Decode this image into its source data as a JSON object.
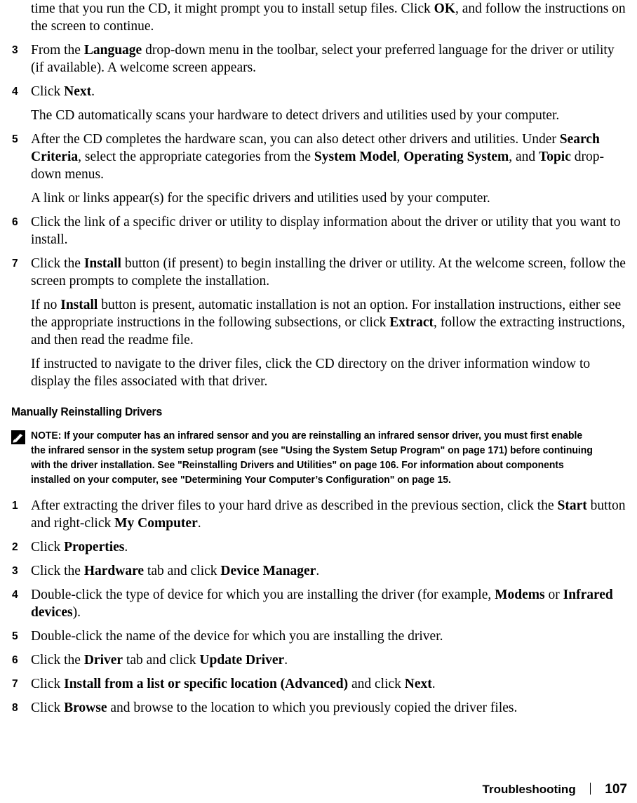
{
  "page": {
    "footer_chapter": "Troubleshooting",
    "footer_separator": "|",
    "footer_page_number": "107"
  },
  "steps_top": [
    {
      "number": "",
      "text_runs": [
        {
          "t": "time that you run the CD, it might prompt you to install setup files. Click ",
          "b": false
        },
        {
          "t": "OK",
          "b": true
        },
        {
          "t": ", and follow the instructions on the screen to continue.",
          "b": false
        }
      ]
    },
    {
      "number": "3",
      "text_runs": [
        {
          "t": "From the ",
          "b": false
        },
        {
          "t": "Language",
          "b": true
        },
        {
          "t": " drop-down menu in the toolbar, select your preferred language for the driver or utility (if available). A welcome screen appears.",
          "b": false
        }
      ]
    },
    {
      "number": "4",
      "text_runs": [
        {
          "t": "Click ",
          "b": false
        },
        {
          "t": "Next",
          "b": true
        },
        {
          "t": ".",
          "b": false
        }
      ]
    },
    {
      "number": "",
      "continuation": true,
      "text_runs": [
        {
          "t": "The CD automatically scans your hardware to detect drivers and utilities used by your computer.",
          "b": false
        }
      ]
    },
    {
      "number": "5",
      "text_runs": [
        {
          "t": "After the CD completes the hardware scan, you can also detect other drivers and utilities. Under ",
          "b": false
        },
        {
          "t": "Search Criteria",
          "b": true
        },
        {
          "t": ", select the appropriate categories from the ",
          "b": false
        },
        {
          "t": "System Model",
          "b": true
        },
        {
          "t": ", ",
          "b": false
        },
        {
          "t": "Operating System",
          "b": true
        },
        {
          "t": ", and ",
          "b": false
        },
        {
          "t": "Topic",
          "b": true
        },
        {
          "t": " drop-down menus.",
          "b": false
        }
      ]
    },
    {
      "number": "",
      "continuation": true,
      "text_runs": [
        {
          "t": "A link or links appear(s) for the specific drivers and utilities used by your computer.",
          "b": false
        }
      ]
    },
    {
      "number": "6",
      "text_runs": [
        {
          "t": "Click the link of a specific driver or utility to display information about the driver or utility that you want to install.",
          "b": false
        }
      ]
    },
    {
      "number": "7",
      "text_runs": [
        {
          "t": "Click the ",
          "b": false
        },
        {
          "t": "Install",
          "b": true
        },
        {
          "t": " button (if present) to begin installing the driver or utility. At the welcome screen, follow the screen prompts to complete the installation.",
          "b": false
        }
      ]
    },
    {
      "number": "",
      "continuation": true,
      "text_runs": [
        {
          "t": "If no ",
          "b": false
        },
        {
          "t": "Install",
          "b": true
        },
        {
          "t": " button is present, automatic installation is not an option. For installation instructions, either see the appropriate instructions in the following subsections, or click ",
          "b": false
        },
        {
          "t": "Extract",
          "b": true
        },
        {
          "t": ", follow the extracting instructions, and then read the readme file.",
          "b": false
        }
      ]
    },
    {
      "number": "",
      "continuation": true,
      "text_runs": [
        {
          "t": "If instructed to navigate to the driver files, click the CD directory on the driver information window to display the files associated with that driver.",
          "b": false
        }
      ]
    }
  ],
  "section": {
    "heading": "Manually Reinstalling Drivers"
  },
  "note": {
    "icon": "pencil-note-icon",
    "label": "NOTE:",
    "text": " If your computer has an infrared sensor and you are reinstalling an infrared sensor driver, you must first enable the infrared sensor in the system setup program (see \"Using the System Setup Program\" on page 171) before continuing with the driver installation. See \"Reinstalling Drivers and Utilities\" on page 106. For information about components installed on your computer, see \"Determining Your Computer’s Configuration\" on page 15."
  },
  "steps_bottom": [
    {
      "number": "1",
      "text_runs": [
        {
          "t": "After extracting the driver files to your hard drive as described in the previous section, click the ",
          "b": false
        },
        {
          "t": "Start",
          "b": true
        },
        {
          "t": " button and right-click ",
          "b": false
        },
        {
          "t": "My Computer",
          "b": true
        },
        {
          "t": ".",
          "b": false
        }
      ]
    },
    {
      "number": "2",
      "text_runs": [
        {
          "t": "Click ",
          "b": false
        },
        {
          "t": "Properties",
          "b": true
        },
        {
          "t": ".",
          "b": false
        }
      ]
    },
    {
      "number": "3",
      "text_runs": [
        {
          "t": "Click the ",
          "b": false
        },
        {
          "t": "Hardware",
          "b": true
        },
        {
          "t": " tab and click ",
          "b": false
        },
        {
          "t": "Device Manager",
          "b": true
        },
        {
          "t": ".",
          "b": false
        }
      ]
    },
    {
      "number": "4",
      "text_runs": [
        {
          "t": "Double-click the type of device for which you are installing the driver (for example, ",
          "b": false
        },
        {
          "t": "Modems",
          "b": true
        },
        {
          "t": " or ",
          "b": false
        },
        {
          "t": "Infrared devices",
          "b": true
        },
        {
          "t": ").",
          "b": false
        }
      ]
    },
    {
      "number": "5",
      "text_runs": [
        {
          "t": "Double-click the name of the device for which you are installing the driver.",
          "b": false
        }
      ]
    },
    {
      "number": "6",
      "text_runs": [
        {
          "t": "Click the ",
          "b": false
        },
        {
          "t": "Driver",
          "b": true
        },
        {
          "t": " tab and click ",
          "b": false
        },
        {
          "t": "Update Driver",
          "b": true
        },
        {
          "t": ".",
          "b": false
        }
      ]
    },
    {
      "number": "7",
      "text_runs": [
        {
          "t": "Click ",
          "b": false
        },
        {
          "t": "Install from a list or specific location (Advanced)",
          "b": true
        },
        {
          "t": " and click ",
          "b": false
        },
        {
          "t": "Next",
          "b": true
        },
        {
          "t": ".",
          "b": false
        }
      ]
    },
    {
      "number": "8",
      "text_runs": [
        {
          "t": "Click ",
          "b": false
        },
        {
          "t": "Browse",
          "b": true
        },
        {
          "t": " and browse to the location to which you previously copied the driver files.",
          "b": false
        }
      ]
    }
  ]
}
